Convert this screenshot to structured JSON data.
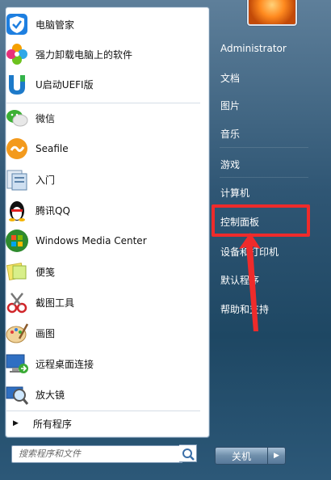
{
  "programs": [
    {
      "label": "电脑管家",
      "icon": "shield-check-icon"
    },
    {
      "label": "强力卸载电脑上的软件",
      "icon": "colorful-flower-icon"
    },
    {
      "label": "U启动UEFI版",
      "icon": "u-logo-icon"
    },
    {
      "label": "微信",
      "icon": "wechat-icon"
    },
    {
      "label": "Seafile",
      "icon": "seafile-icon"
    },
    {
      "label": "入门",
      "icon": "getting-started-icon"
    },
    {
      "label": "腾讯QQ",
      "icon": "qq-penguin-icon"
    },
    {
      "label": "Windows Media Center",
      "icon": "windows-media-center-icon"
    },
    {
      "label": "便笺",
      "icon": "sticky-notes-icon"
    },
    {
      "label": "截图工具",
      "icon": "snipping-tool-icon"
    },
    {
      "label": "画图",
      "icon": "paint-icon"
    },
    {
      "label": "远程桌面连接",
      "icon": "remote-desktop-icon"
    },
    {
      "label": "放大镜",
      "icon": "magnifier-icon"
    }
  ],
  "all_programs": "所有程序",
  "search": {
    "placeholder": "搜索程序和文件",
    "icon": "search-icon"
  },
  "right_links": [
    {
      "label": "Administrator"
    },
    {
      "label": "文档"
    },
    {
      "label": "图片"
    },
    {
      "label": "音乐"
    },
    {
      "label": "游戏"
    },
    {
      "label": "计算机"
    },
    {
      "label": "控制面板"
    },
    {
      "label": "设备和打印机"
    },
    {
      "label": "默认程序"
    },
    {
      "label": "帮助和支持"
    }
  ],
  "shutdown": {
    "label": "关机",
    "arrow_icon": "chevron-right-icon"
  },
  "colors": {
    "highlight": "#ee2b2b",
    "panel_bg": "#ffffff",
    "right_bg": "#2f5674"
  }
}
